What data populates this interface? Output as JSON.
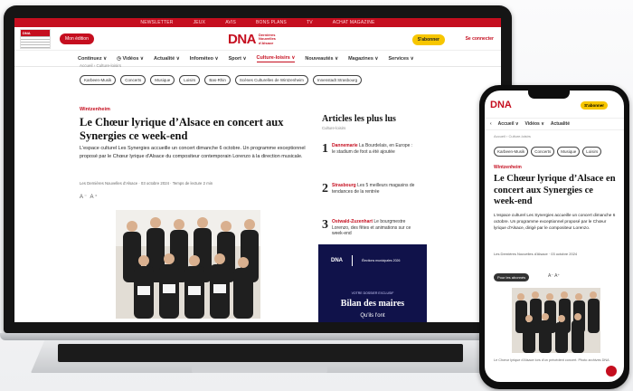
{
  "site": {
    "logo": "DNA",
    "logo_sub": [
      "Dernières",
      "Nouvelles",
      "d'Alsace"
    ],
    "brand_color": "#c50e1f",
    "topstrip": [
      "NEWSLETTER",
      "JEUX",
      "AVIS",
      "BONS PLANS",
      "TV",
      "ACHAT MAGAZINE"
    ],
    "edition_label": "DNA",
    "edition_button": "Mon édition",
    "subscribe": "S'abonner",
    "login": "Se connecter"
  },
  "nav": {
    "items": [
      "Continuez ∨",
      "◷ Vidéos ∨",
      "Actualité ∨",
      "Infométeo ∨",
      "Sport ∨",
      "Culture-loisirs ∨",
      "Nouveautés ∨",
      "Magazines ∨",
      "Services ∨"
    ],
    "active": "Culture-loisirs ∨"
  },
  "breadcrumb": "Accueil › Culture-loisirs",
  "tags": [
    "Karbeen-Musik",
    "Concerts",
    "Musique",
    "Loisirs",
    "Bas-Rhin",
    "Scènes Culturelles de Wintzenheim",
    "Innenstadt Strasbourg"
  ],
  "article": {
    "rubrique": "Wintzenheim",
    "title": "Le Chœur lyrique d’Alsace en concert aux Synergies ce week-end",
    "lead": "L'espace culturel Les Synergies accueille un concert dimanche 6 octobre. Un programme exceptionnel proposé par le Chœur lyrique d'Alsace du compositeur contemporain Lorenzo à la direction musicale.",
    "byline": "Les Dernières Nouvelles d'Alsace · 03 octobre 2024 · Temps de lecture 2 min",
    "font_controls": "A⁻  A⁺"
  },
  "sidebar": {
    "title": "Articles les plus lus",
    "subtitle": "Culture-loisirs",
    "items": [
      {
        "num": "1",
        "place": "Dannemarie",
        "text": "La Bourdelais, en Europe : le stadium de foot a été ajoutée"
      },
      {
        "num": "2",
        "place": "Strasbourg",
        "text": "Les 5 meilleurs magasins de tendances de la rentrée"
      },
      {
        "num": "3",
        "place": "Ostwald-Zuzenhart",
        "text": "Le bourgmestre Lorenzo, des fêtes et animations sur ce week-end"
      }
    ]
  },
  "ad": {
    "logo": "DNA",
    "partner": "Élections municipales 2026",
    "small": "VOTRE DOSSIER EXCLUSIF",
    "headline": "Bilan des maires",
    "cut": "Qu'ils l'ont"
  },
  "phone": {
    "logo": "DNA",
    "subscribe": "S'abonner",
    "nav": [
      "‹",
      "Accueil ∨",
      "Vidéos ∨",
      "Actualité"
    ],
    "breadcrumb": "Accueil › Culture-loisirs",
    "tags": [
      "Karbeen-Musik",
      "Concerts",
      "Musique",
      "Loisirs"
    ],
    "rubrique": "Wintzenheim",
    "title": "Le Chœur lyrique d’Alsace en concert aux Synergies ce week-end",
    "lead": "L'espace culturel Les Synergies accueille un concert dimanche 6 octobre. Un programme exceptionnel proposé par le Chœur lyrique d'Alsace, dirigé par le compositeur Lorenzo.",
    "byline": "Les Dernières Nouvelles d'Alsace · 03 octobre 2024",
    "badge": "Pour les abonnés",
    "font_controls": "A⁻  A⁺",
    "caption": "Le Chœur lyrique d'Alsace lors d'un précédent concert. Photo archives DNA"
  }
}
